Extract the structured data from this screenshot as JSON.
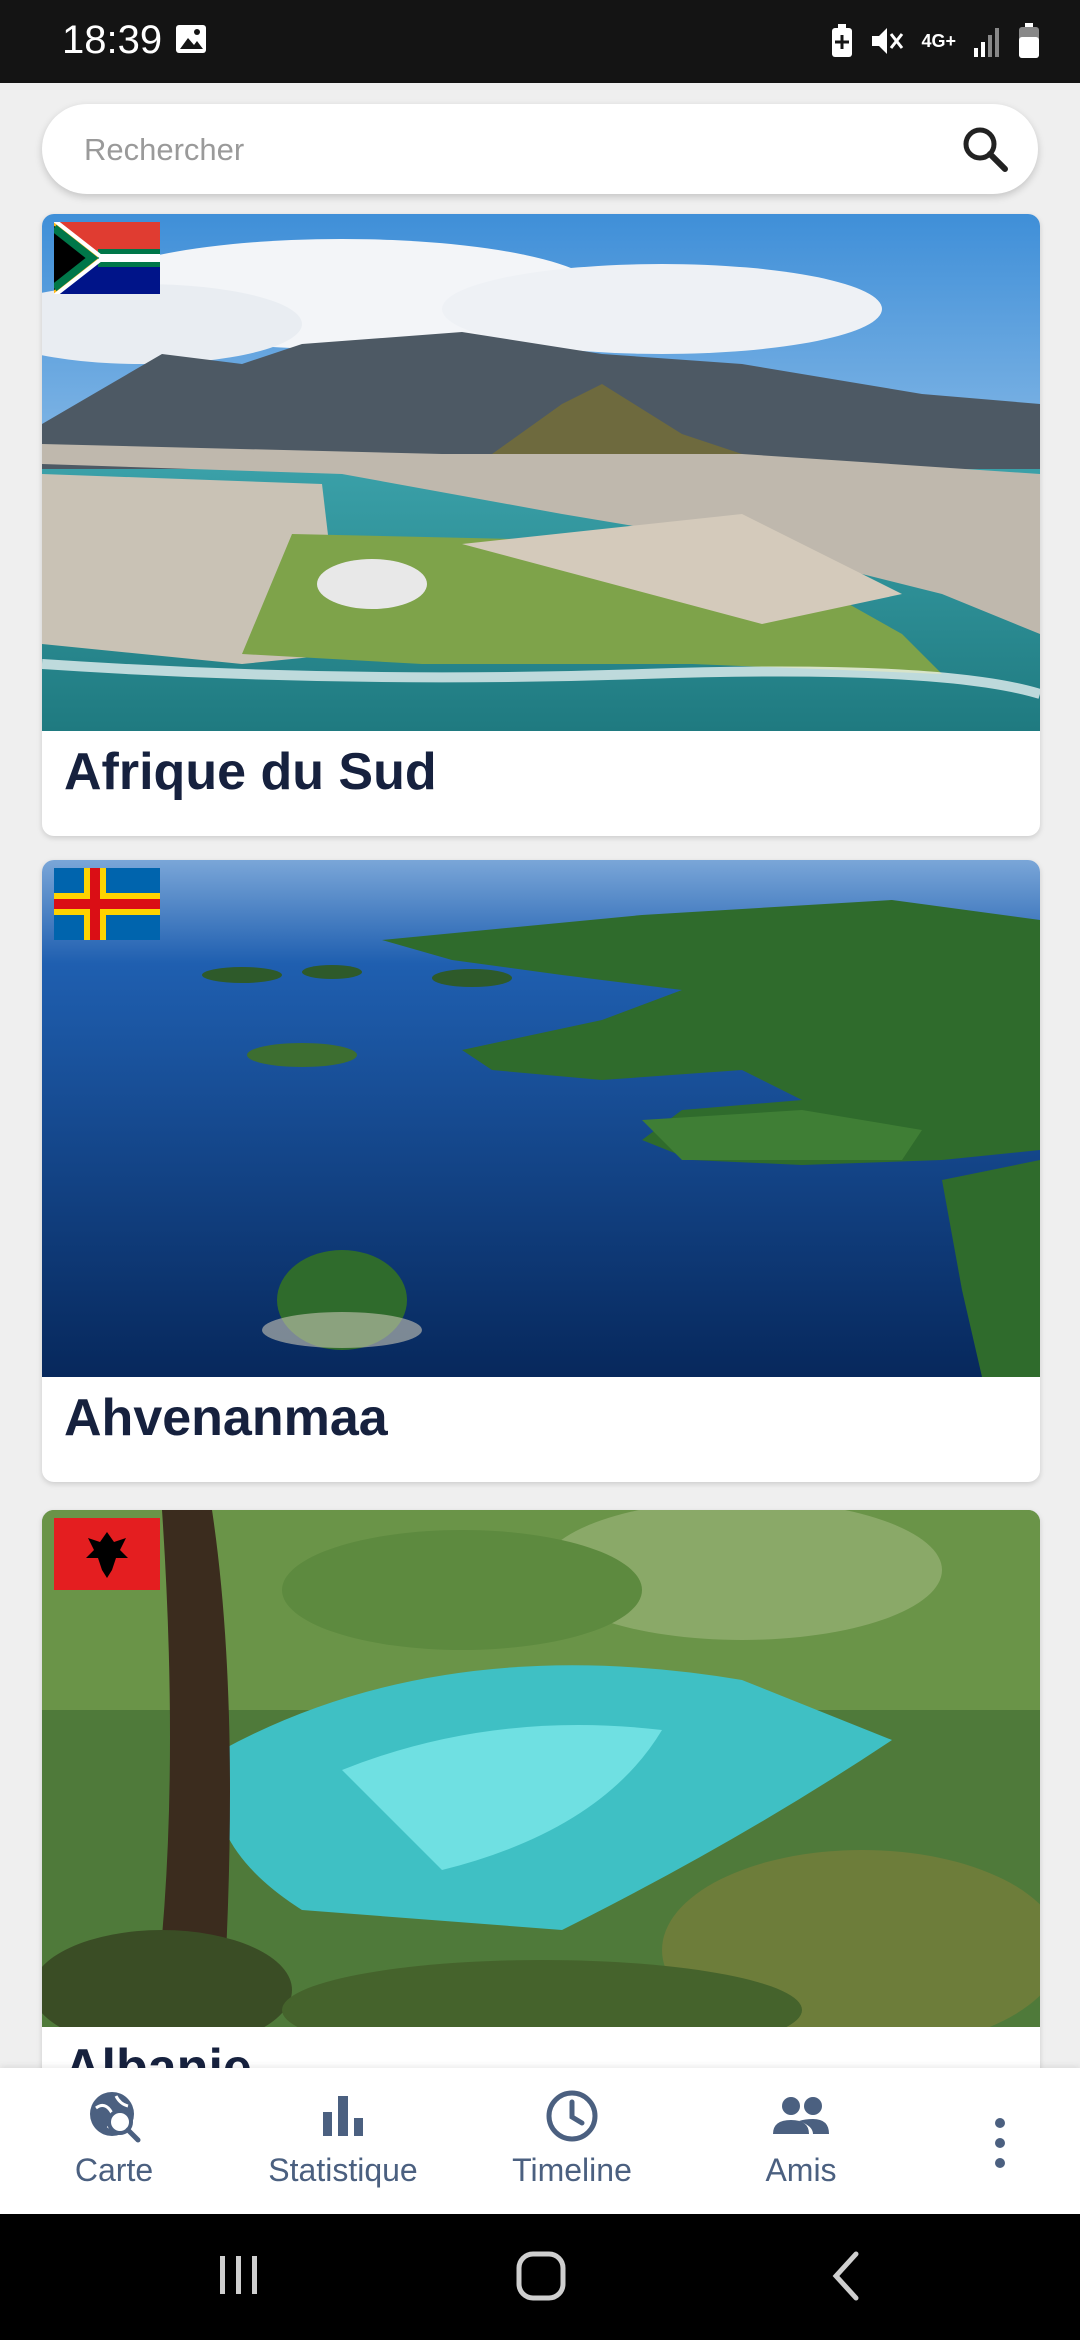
{
  "status_bar": {
    "time": "18:39",
    "network_label": "4G+",
    "icons": [
      "gallery-icon",
      "battery-saver-icon",
      "mute-icon",
      "signal-icon",
      "battery-icon"
    ]
  },
  "search": {
    "placeholder": "Rechercher",
    "value": "",
    "icon": "search-icon"
  },
  "countries": [
    {
      "name": "Afrique du Sud",
      "flag": "south-africa-flag"
    },
    {
      "name": "Ahvenanmaa",
      "flag": "aland-flag"
    },
    {
      "name": "Albanie",
      "flag": "albania-flag"
    }
  ],
  "bottom_nav": {
    "items": [
      {
        "label": "Carte",
        "icon": "map-search-icon"
      },
      {
        "label": "Statistique",
        "icon": "bar-chart-icon"
      },
      {
        "label": "Timeline",
        "icon": "clock-icon"
      },
      {
        "label": "Amis",
        "icon": "people-icon"
      }
    ],
    "more_icon": "more-vert-icon"
  },
  "system_nav": [
    "recent-apps-icon",
    "home-icon",
    "back-icon"
  ],
  "colors": {
    "accent": "#4b6080",
    "title": "#16213e",
    "background": "#efefef"
  }
}
